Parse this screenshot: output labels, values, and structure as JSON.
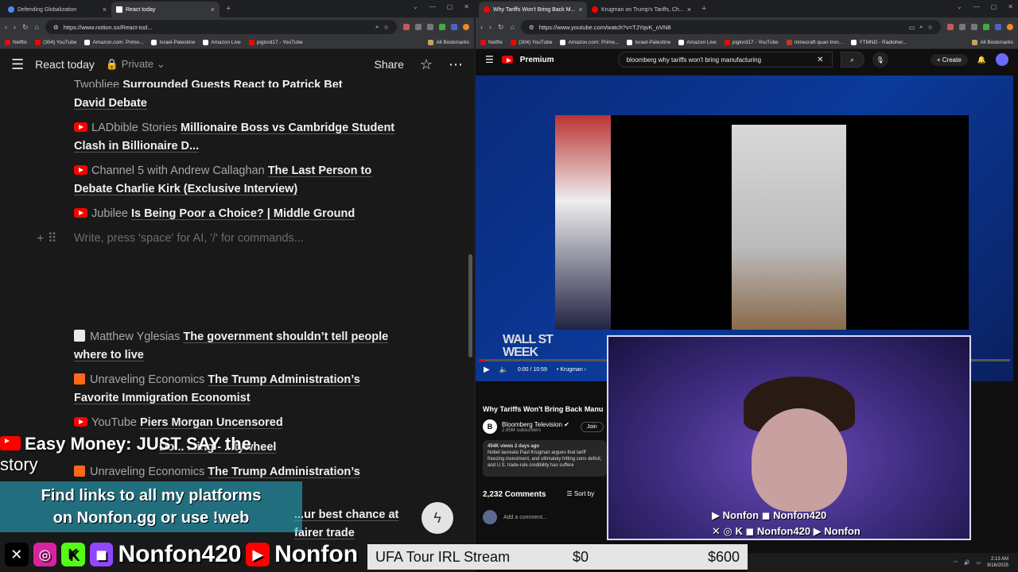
{
  "left_browser": {
    "tabs": [
      {
        "label": "Defending Globalization",
        "active": false
      },
      {
        "label": "React today",
        "active": true
      }
    ],
    "url": "https://www.notion.so/React-tod...",
    "bookmarks": [
      "Netflix",
      "(304) YouTube",
      "Amazon.com: Prime...",
      "Israel-Palestine",
      "Amazon Live",
      "piglord17 - YouTube"
    ],
    "all_bookmarks": "All Bookmarks"
  },
  "notion": {
    "page_title": "React today",
    "privacy": "Private",
    "share": "Share",
    "entries": [
      {
        "icon": "youtube",
        "source": "Twobliee",
        "title": "Surrounded Guests React to Patrick Bet"
      },
      {
        "icon": "none",
        "source": "",
        "title": "David Debate"
      },
      {
        "icon": "youtube",
        "source": "LADbible Stories",
        "title": "Millionaire Boss vs Cambridge Student Clash in Billionaire D..."
      },
      {
        "icon": "youtube",
        "source": "Channel 5 with Andrew Callaghan",
        "title": "The Last Person to Debate Charlie Kirk (Exclusive Interview)"
      },
      {
        "icon": "youtube",
        "source": "Jubilee",
        "title": "Is Being Poor a Choice? | Middle Ground"
      }
    ],
    "placeholder": "Write, press 'space' for AI, '/' for commands...",
    "entries2": [
      {
        "icon": "my",
        "source": "Matthew Yglesias",
        "title": "The government shouldn’t tell people where to live"
      },
      {
        "icon": "substack",
        "source": "Unraveling Economics",
        "title": "The Trump Administration’s Favorite Immigration Economist"
      },
      {
        "icon": "youtube",
        "source": "YouTube",
        "title": "Piers Morgan Uncensored"
      },
      {
        "icon": "youtube",
        "source": "",
        "title": "Do... ...ing - ...tywheel"
      },
      {
        "icon": "substack",
        "source": "Unraveling Economics",
        "title": "The Trump Administration’s"
      },
      {
        "icon": "none",
        "source": "",
        "title": "...ur best chance at fairer trade"
      }
    ]
  },
  "overlay": {
    "easy_money": "Easy Money: JUST SAY the",
    "story": "story",
    "find_links_1": "Find links to all my platforms",
    "find_links_2": "on Nonfon.gg or use !web",
    "handle_1": "Nonfon420",
    "handle_2": "Nonfon",
    "cam_handle_1": "Nonfon420",
    "cam_handle_2": "Nonfon",
    "goal_name": "UFA Tour IRL Stream",
    "goal_current": "$0",
    "goal_target": "$600"
  },
  "right_browser": {
    "tabs": [
      {
        "label": "Why Tariffs Won't Bring Back M...",
        "active": true
      },
      {
        "label": "Krugman on Trump's Tariffs, Ch...",
        "active": false
      }
    ],
    "url": "https://www.youtube.com/watch?v=TJYqvK_oVN8",
    "bookmarks": [
      "Netflix",
      "(304) YouTube",
      "Amazon.com: Prime...",
      "Israel-Palestine",
      "Amazon Live",
      "piglord17 - YouTube",
      "minecraft quan tron...",
      "YTMND - Radioher..."
    ],
    "all_bookmarks": "All Bookmarks"
  },
  "youtube": {
    "brand": "Premium",
    "search_query": "bloomberg why tariffs won't bring manufacturing",
    "create": "Create",
    "time": "0:00 / 10:59",
    "chapter": "Krugman",
    "wall_st_1": "WALL ST",
    "wall_st_2": "WEEK",
    "video_title": "Why Tariffs Won't Bring Back Manu",
    "channel": "Bloomberg Television",
    "subscribers": "2.85M subscribers",
    "join": "Join",
    "views": "454K views  2 days ago",
    "description": "Nobel laureate Paul Krugman argues that tariff freezing investment, and ultimately hitting cons deficit, and U.S. trade-rule credibility has suffere",
    "comments_count": "2,232 Comments",
    "sort_by": "Sort by",
    "add_comment": "Add a comment...",
    "progress": 0.01
  },
  "system": {
    "time": "2:13 AM",
    "date": "9/16/2025"
  },
  "colors": {
    "youtube_red": "#ff0000",
    "substack_orange": "#ff6719",
    "notion_bg": "#191919",
    "overlay_cyan": "#28b4d2"
  }
}
